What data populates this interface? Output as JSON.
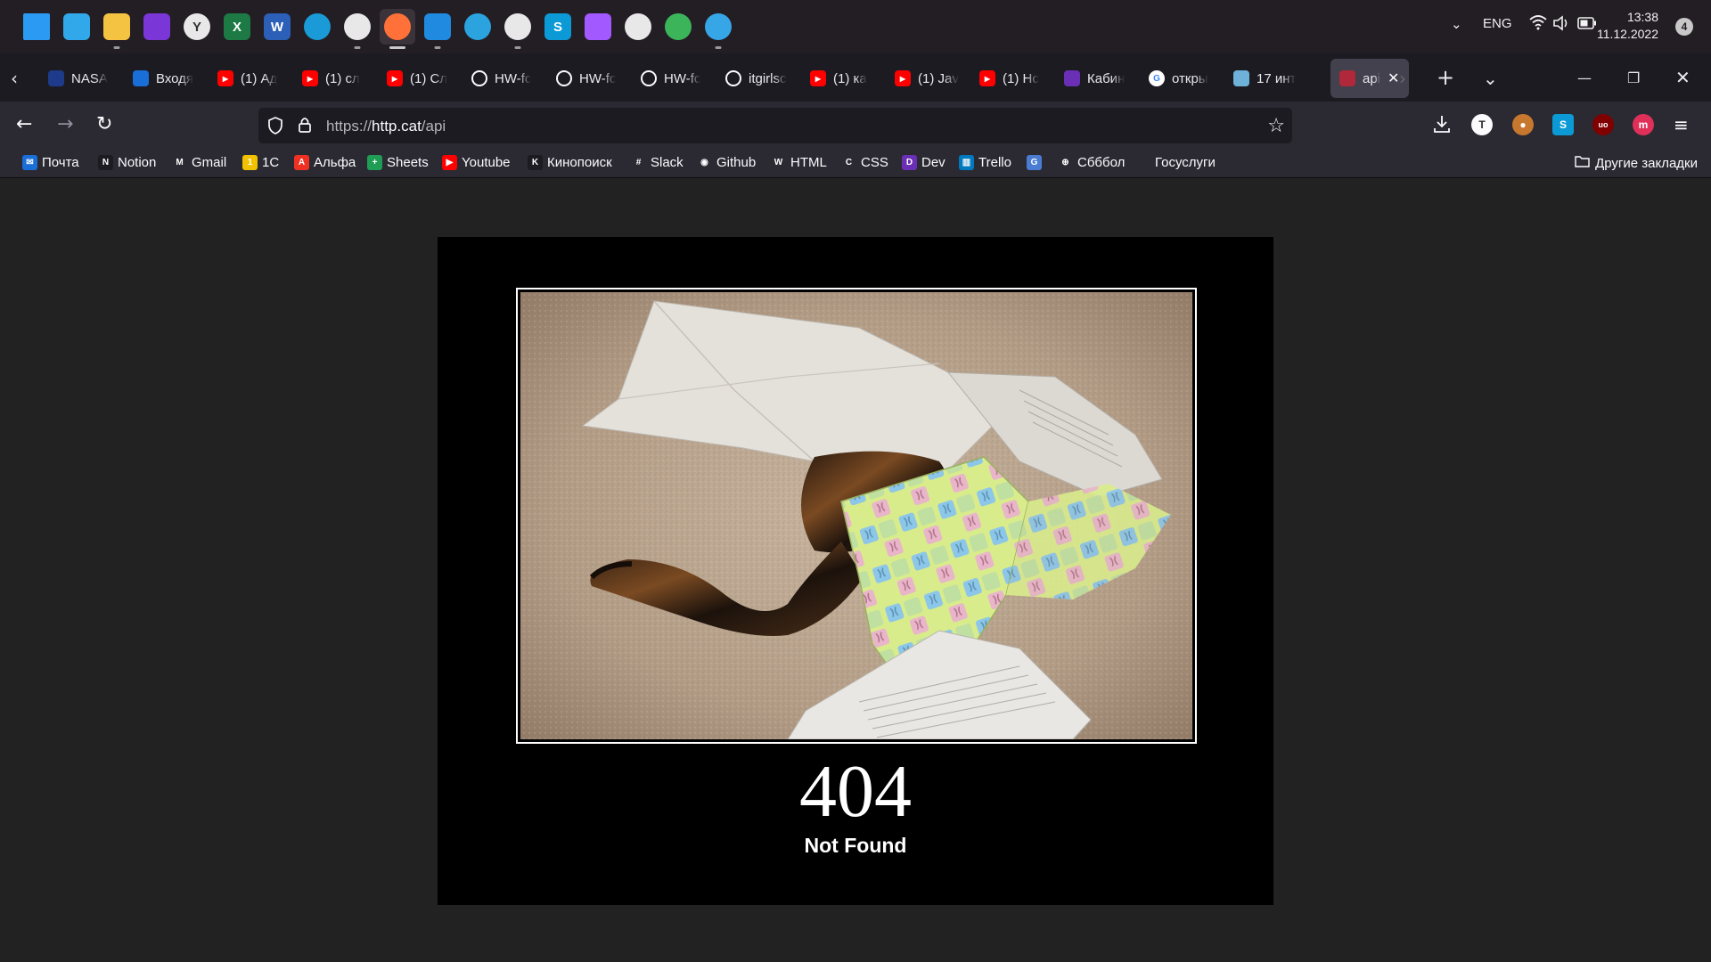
{
  "taskbar": {
    "apps": [
      {
        "name": "start",
        "glyph": "",
        "color": "#2b9af3"
      },
      {
        "name": "whiteboard",
        "glyph": "",
        "color": "#31a8ea"
      },
      {
        "name": "file-explorer",
        "glyph": "",
        "color": "#f5c342"
      },
      {
        "name": "podcasts",
        "glyph": "",
        "color": "#7a36d6"
      },
      {
        "name": "yandex-browser",
        "glyph": "Y",
        "color": "#e8e8e8"
      },
      {
        "name": "excel",
        "glyph": "X",
        "color": "#1d7a45"
      },
      {
        "name": "word",
        "glyph": "W",
        "color": "#2b5fb8"
      },
      {
        "name": "edge",
        "glyph": "",
        "color": "#1a9ad6"
      },
      {
        "name": "chrome",
        "glyph": "",
        "color": "#e8e8e8"
      },
      {
        "name": "firefox",
        "glyph": "",
        "color": "#ff7139"
      },
      {
        "name": "vscode",
        "glyph": "",
        "color": "#1f8ae0"
      },
      {
        "name": "telegram",
        "glyph": "",
        "color": "#2aa3df"
      },
      {
        "name": "slack",
        "glyph": "",
        "color": "#e8e8e8"
      },
      {
        "name": "skype",
        "glyph": "S",
        "color": "#0c9ad6"
      },
      {
        "name": "figma",
        "glyph": "",
        "color": "#a259ff"
      },
      {
        "name": "git-tool",
        "glyph": "",
        "color": "#e8e8e8"
      },
      {
        "name": "send-app",
        "glyph": "",
        "color": "#3cb55a"
      },
      {
        "name": "paint-app",
        "glyph": "",
        "color": "#36a6e6"
      }
    ],
    "language": "ENG",
    "time": "13:38",
    "date": "11.12.2022",
    "notifications": "4"
  },
  "tabs": [
    {
      "label": "NASA",
      "icon": "nasa-icon",
      "color": "#1d3b8a"
    },
    {
      "label": "Входя",
      "icon": "mail-icon",
      "color": "#1a6ed8"
    },
    {
      "label": "(1) Ад",
      "icon": "youtube-icon",
      "color": "#ff0000"
    },
    {
      "label": "(1) сл",
      "icon": "youtube-icon",
      "color": "#ff0000"
    },
    {
      "label": "(1) Сл",
      "icon": "youtube-icon",
      "color": "#ff0000"
    },
    {
      "label": "HW-fc",
      "icon": "github-icon",
      "color": "#1c1b22"
    },
    {
      "label": "HW-fc",
      "icon": "github-icon",
      "color": "#1c1b22"
    },
    {
      "label": "HW-fc",
      "icon": "github-icon",
      "color": "#1c1b22"
    },
    {
      "label": "itgirlsc",
      "icon": "github-icon",
      "color": "#1c1b22"
    },
    {
      "label": "(1) ка",
      "icon": "youtube-icon",
      "color": "#ff0000"
    },
    {
      "label": "(1) Jav",
      "icon": "youtube-icon",
      "color": "#ff0000"
    },
    {
      "label": "(1) Hc",
      "icon": "youtube-icon",
      "color": "#ff0000"
    },
    {
      "label": "Кабин",
      "icon": "cabinet-icon",
      "color": "#6a2fb5"
    },
    {
      "label": "откры",
      "icon": "google-icon",
      "color": "#ffffff"
    },
    {
      "label": "17 инт",
      "icon": "site-icon",
      "color": "#6fb2d9"
    },
    {
      "label": "api",
      "icon": "http-cat-icon",
      "color": "#b0283a",
      "selected": true
    }
  ],
  "nav": {
    "url_prefix": "https://",
    "url_host": "http.cat",
    "url_path": "/api"
  },
  "bookmarks": [
    {
      "label": "Почта",
      "icon": "mail-icon",
      "color": "#1a6ed8",
      "glyph": "✉"
    },
    {
      "label": "Notion",
      "icon": "notion-icon",
      "color": "#1c1b22",
      "glyph": "N"
    },
    {
      "label": "Gmail",
      "icon": "gmail-icon",
      "color": "#2b2a33",
      "glyph": "M"
    },
    {
      "label": "1С",
      "icon": "1c-icon",
      "color": "#f2c200",
      "glyph": "1"
    },
    {
      "label": "Альфа",
      "icon": "alfa-icon",
      "color": "#ef3124",
      "glyph": "A"
    },
    {
      "label": "Sheets",
      "icon": "sheets-icon",
      "color": "#1f9d55",
      "glyph": "+"
    },
    {
      "label": "Youtube",
      "icon": "youtube-icon",
      "color": "#ff0000",
      "glyph": "▶"
    },
    {
      "label": "Кинопоиск",
      "icon": "kinopoisk-icon",
      "color": "#1c1b22",
      "glyph": "K"
    },
    {
      "label": "Slack",
      "icon": "slack-icon",
      "color": "#2b2a33",
      "glyph": "#"
    },
    {
      "label": "Github",
      "icon": "github-icon",
      "color": "#2b2a33",
      "glyph": "◉"
    },
    {
      "label": "HTML",
      "icon": "w3-icon",
      "color": "#2b2a33",
      "glyph": "W"
    },
    {
      "label": "CSS",
      "icon": "css-icon",
      "color": "#2b2a33",
      "glyph": "C"
    },
    {
      "label": "Dev",
      "icon": "dev-icon",
      "color": "#6a2fb5",
      "glyph": "D"
    },
    {
      "label": "Trello",
      "icon": "trello-icon",
      "color": "#0079bf",
      "glyph": "▥"
    },
    {
      "label": "",
      "icon": "translate-icon",
      "color": "#4a7cd4",
      "glyph": "G"
    },
    {
      "label": "Сбббол",
      "icon": "globe-icon",
      "color": "#2b2a33",
      "glyph": "⊕"
    },
    {
      "label": "Госуслуги",
      "icon": "gosuslugi-icon",
      "color": "#2b2a33",
      "glyph": ""
    }
  ],
  "other_bookmarks": "Другие закладки",
  "content": {
    "status_code": "404",
    "status_text": "Not Found"
  }
}
